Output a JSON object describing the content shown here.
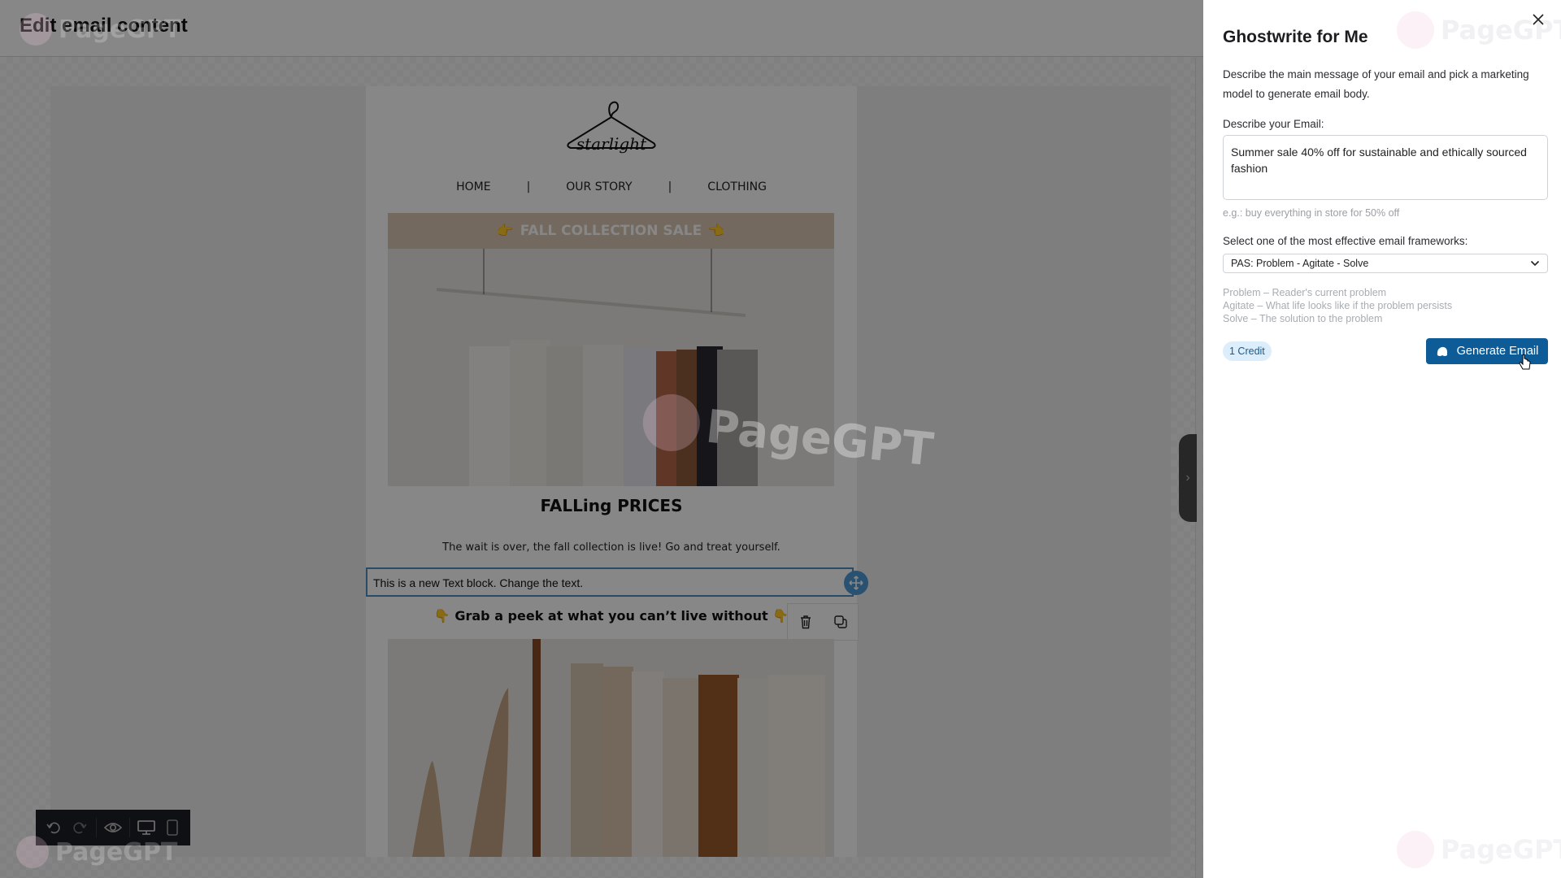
{
  "editor": {
    "title": "Edit email content",
    "email": {
      "brand": "starlight",
      "nav": [
        "HOME",
        "|",
        "OUR STORY",
        "|",
        "CLOTHING"
      ],
      "banner_title": "FALL COLLECTION SALE",
      "banner_emoji": "👉",
      "headline": "FALLing PRICES",
      "subtext": "The wait is over, the fall collection is live! Go and treat yourself.",
      "selected_text_block": "This is a new Text block. Change the text.",
      "peek_text": "Grab a peek at what you can’t live without",
      "peek_emoji": "👇"
    },
    "block_tools": [
      "delete-icon",
      "duplicate-icon"
    ],
    "toolbar": [
      "undo-icon",
      "redo-icon",
      "preview-icon",
      "desktop-icon",
      "mobile-icon"
    ]
  },
  "watermark": "PageGPT",
  "panel": {
    "title": "Ghostwrite for Me",
    "description": "Describe the main message of your email and pick a marketing model to generate email body.",
    "email_label": "Describe your Email:",
    "email_value": "Summer sale 40% off for sustainable and ethically sourced fashion",
    "email_hint": "e.g.: buy everything in store for 50% off",
    "framework_label": "Select one of the most effective email frameworks:",
    "framework_selected": "PAS: Problem - Agitate - Solve",
    "framework_desc": [
      "Problem – Reader's current problem",
      "Agitate – What life looks like if the problem persists",
      "Solve – The solution to the problem"
    ],
    "credit_badge": "1 Credit",
    "generate_label": "Generate Email",
    "accent_color": "#0d5b97"
  }
}
